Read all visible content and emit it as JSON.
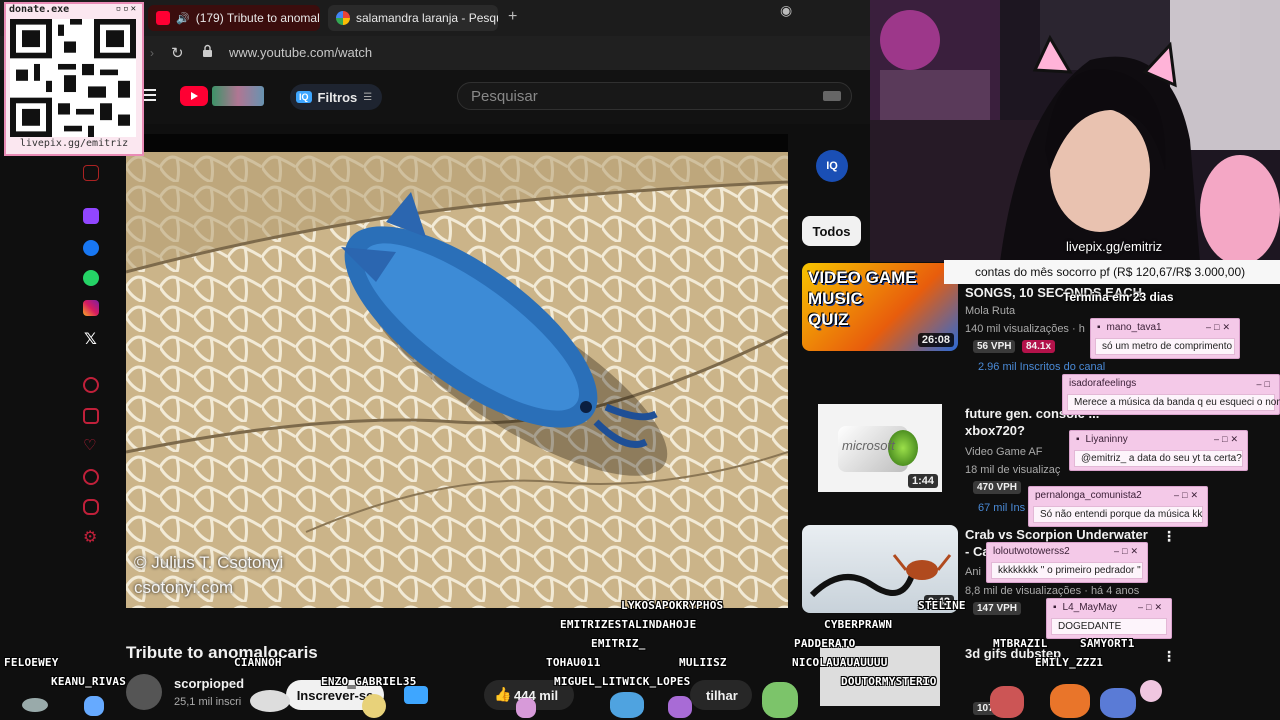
{
  "browser": {
    "tabs": [
      {
        "label": "(179) Tribute to anomal"
      },
      {
        "label": "salamandra laranja - Pesqu"
      }
    ],
    "new_tab": "+",
    "url": "www.youtube.com/watch"
  },
  "youtube": {
    "filters_label": "Filtros",
    "search_placeholder": "Pesquisar",
    "video": {
      "credit_line1": "© Julius T. Csotonyi",
      "credit_line2": "csotonyi.com",
      "title": "Tribute to anomalocaris",
      "channel": "scorpioped",
      "subscribers": "25,1 mil inscri",
      "subscribe_label": "Inscrever-se",
      "likes": "444 mil",
      "share_label": "tilhar"
    },
    "chip_all": "Todos",
    "recommendations": [
      {
        "thumb_text": [
          "VIDEO GAME",
          "MUSIC",
          "QUIZ"
        ],
        "duration": "26:08",
        "title": "SONGS, 10 SECONDS EACH",
        "channel": "Mola Ruta",
        "meta": "140 mil visualizações · h",
        "vph": "56 VPH",
        "multiplier": "84.1x",
        "subs": "2.96 mil Inscritos do canal"
      },
      {
        "thumb_text": [
          "microsoft"
        ],
        "duration": "1:44",
        "title": "future gen. console ... xbox720?",
        "channel": "Video Game AF",
        "meta": "18 mil de visualizaç",
        "vph": "470 VPH",
        "subs": "67 mil Ins"
      },
      {
        "duration": "9:42",
        "title": "Crab vs Scorpion Underwater - Car",
        "channel": "Ani",
        "meta": "8,8 mil de visualizações · há 4 anos",
        "vph": "147 VPH"
      },
      {
        "title": "3d gifs dubstep",
        "meta": "107 VPH"
      }
    ]
  },
  "stream": {
    "donate_title": "donate.exe",
    "donate_url": "livepix.gg/emitriz",
    "cam_tag": "livepix.gg/emitriz",
    "goal_text": "contas do mês socorro pf (R$ 120,67/R$ 3.000,00)",
    "goal_end": "Termina em 23 dias",
    "chat_windows": [
      {
        "user": "mano_tava1",
        "message": "só um metro de comprimento"
      },
      {
        "user": "isadorafeelings",
        "message": "Merece a música da banda q eu esqueci o nome"
      },
      {
        "user": "Liyaninny",
        "message": "@emitriz_ a data do seu yt ta certa?"
      },
      {
        "user": "pernalonga_comunista2",
        "message": "Só não entendi porque da música kk"
      },
      {
        "user": "loloutwotowerss2",
        "message": "kkkkkkkk \" o primeiro pedrador \""
      },
      {
        "user": "L4_MayMay",
        "message": "DOGEDANTE"
      }
    ],
    "chat_names": [
      "LYKOSAPOKRYPHOS",
      "EMITRIZESTALINDAHOJE",
      "EMITRIZ_",
      "CYBERPRAWN",
      "STELINE",
      "PADDERATO",
      "MTBRAZIL",
      "SAMYORT1",
      "TOHAU011",
      "MULIISZ",
      "NICOLAUAUAUUUU",
      "EMILY_ZZZ1",
      "FELOEWEY",
      "CIANNOH",
      "KEANU_RIVAS",
      "ENZO_GABRIEL35",
      "MIGUEL_LITWICK_LOPES",
      "DOUTORMYSTERIO"
    ]
  },
  "colors": {
    "yt_red": "#ff0033",
    "accent_blue": "#3ea6ff",
    "chat_window": "#f4c9e8",
    "donate_border": "#e98bb5",
    "vph_bg": "#3a3a3a",
    "multiplier_bg": "#b3124a"
  }
}
